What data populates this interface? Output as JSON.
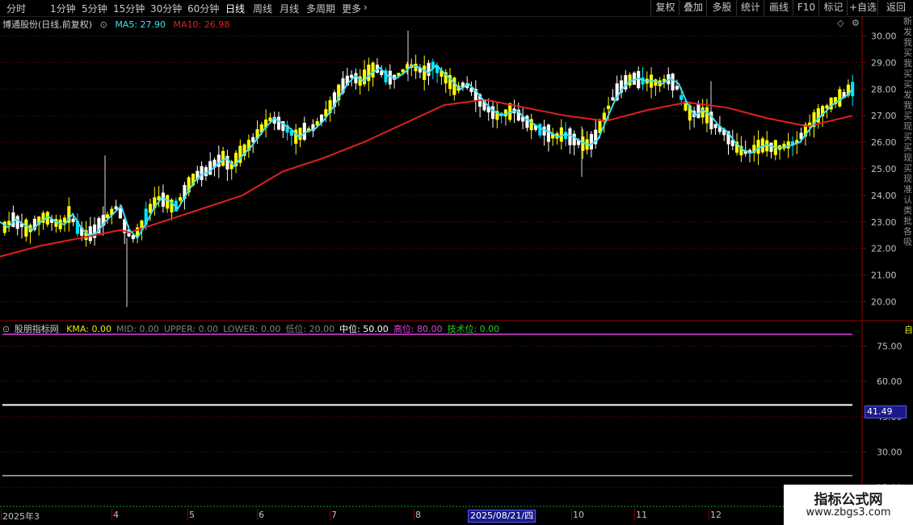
{
  "toolbar": {
    "periods": [
      "分时",
      "1分钟",
      "5分钟",
      "15分钟",
      "30分钟",
      "60分钟",
      "日线",
      "周线",
      "月线",
      "多周期",
      "更多"
    ],
    "active_period": "日线",
    "right_buttons": [
      "复权",
      "叠加",
      "多股",
      "统计",
      "画线",
      "F10",
      "标记",
      "+自选",
      "返回"
    ]
  },
  "main_panel": {
    "title": "博通股份(日线,前复权)",
    "ma5_label": "MA5:",
    "ma5_value": "27.90",
    "ma10_label": "MA10:",
    "ma10_value": "26.98",
    "price_ticks": [
      "30.00",
      "29.00",
      "28.00",
      "27.00",
      "26.00",
      "25.00",
      "24.00",
      "23.00",
      "22.00",
      "21.00",
      "20.00"
    ]
  },
  "indicator_panel": {
    "name": "股朋指标网",
    "items": [
      {
        "label": "KMA:",
        "value": "0.00",
        "color": "#e8e800"
      },
      {
        "label": "MID:",
        "value": "0.00",
        "color": "#808080"
      },
      {
        "label": "UPPER:",
        "value": "0.00",
        "color": "#808080"
      },
      {
        "label": "LOWER:",
        "value": "0.00",
        "color": "#808080"
      },
      {
        "label": "低位:",
        "value": "20.00",
        "color": "#808080"
      },
      {
        "label": "中位:",
        "value": "50.00",
        "color": "#ffffff"
      },
      {
        "label": "高位:",
        "value": "80.00",
        "color": "#e040e0"
      },
      {
        "label": "技术位:",
        "value": "0.00",
        "color": "#20d020"
      }
    ],
    "ticks": [
      "75.00",
      "60.00",
      "45.00",
      "30.00",
      "15.00"
    ],
    "cursor_value": "41.49"
  },
  "date_axis": {
    "labels": [
      "2025年3",
      "4",
      "5",
      "6",
      "7",
      "8",
      "10",
      "11",
      "12"
    ],
    "cursor_date": "2025/08/21/四"
  },
  "side_strip": {
    "top_chars": "新发我买我买买发我买现买买现买现 准认 类 批 各 吸",
    "bottom_chars": "自"
  },
  "watermark": {
    "line1": "指标公式网",
    "line2": "www.zbgs3.com"
  },
  "colors": {
    "up_candle": "#ffff00",
    "down_candle": "#ffffff",
    "special_candle": "#00e5ff",
    "ma5": "#40e0f0",
    "ma10": "#e02020",
    "grid": "#8b0000"
  },
  "chart_data": {
    "type": "candlestick",
    "price_ylim": [
      19.5,
      30.5
    ],
    "ma5_path": [
      [
        0,
        23.0
      ],
      [
        10,
        22.8
      ],
      [
        20,
        23.1
      ],
      [
        30,
        22.9
      ],
      [
        40,
        22.7
      ],
      [
        50,
        23.0
      ],
      [
        60,
        23.2
      ],
      [
        70,
        23.0
      ],
      [
        80,
        22.9
      ],
      [
        90,
        23.3
      ],
      [
        100,
        22.8
      ],
      [
        110,
        22.5
      ],
      [
        120,
        22.6
      ],
      [
        130,
        23.0
      ],
      [
        140,
        23.3
      ],
      [
        150,
        23.6
      ],
      [
        160,
        22.7
      ],
      [
        170,
        22.4
      ],
      [
        180,
        22.9
      ],
      [
        190,
        23.5
      ],
      [
        200,
        23.9
      ],
      [
        210,
        23.8
      ],
      [
        220,
        23.5
      ],
      [
        230,
        24.0
      ],
      [
        240,
        24.5
      ],
      [
        250,
        24.8
      ],
      [
        260,
        24.9
      ],
      [
        270,
        25.2
      ],
      [
        280,
        25.4
      ],
      [
        290,
        25.1
      ],
      [
        300,
        25.5
      ],
      [
        310,
        25.8
      ],
      [
        320,
        26.2
      ],
      [
        330,
        26.6
      ],
      [
        340,
        26.9
      ],
      [
        350,
        26.7
      ],
      [
        360,
        26.5
      ],
      [
        370,
        26.2
      ],
      [
        380,
        26.4
      ],
      [
        390,
        26.5
      ],
      [
        400,
        26.8
      ],
      [
        410,
        27.2
      ],
      [
        420,
        27.7
      ],
      [
        430,
        28.2
      ],
      [
        440,
        28.5
      ],
      [
        450,
        28.3
      ],
      [
        460,
        28.6
      ],
      [
        470,
        28.8
      ],
      [
        480,
        28.5
      ],
      [
        490,
        28.4
      ],
      [
        500,
        28.6
      ],
      [
        510,
        28.9
      ],
      [
        520,
        28.8
      ],
      [
        530,
        28.6
      ],
      [
        540,
        28.9
      ],
      [
        550,
        28.6
      ],
      [
        560,
        28.3
      ],
      [
        570,
        28.0
      ],
      [
        580,
        28.2
      ],
      [
        590,
        27.9
      ],
      [
        600,
        27.5
      ],
      [
        610,
        27.2
      ],
      [
        620,
        27.0
      ],
      [
        630,
        27.1
      ],
      [
        640,
        27.2
      ],
      [
        650,
        26.9
      ],
      [
        660,
        26.7
      ],
      [
        670,
        26.5
      ],
      [
        680,
        26.4
      ],
      [
        690,
        26.2
      ],
      [
        700,
        26.3
      ],
      [
        710,
        26.2
      ],
      [
        720,
        26.0
      ],
      [
        730,
        25.9
      ],
      [
        740,
        26.1
      ],
      [
        750,
        26.8
      ],
      [
        760,
        27.5
      ],
      [
        770,
        28.0
      ],
      [
        780,
        28.3
      ],
      [
        790,
        28.4
      ],
      [
        800,
        28.3
      ],
      [
        810,
        28.3
      ],
      [
        820,
        28.2
      ],
      [
        830,
        28.4
      ],
      [
        840,
        28.2
      ],
      [
        850,
        27.5
      ],
      [
        860,
        27.0
      ],
      [
        870,
        27.2
      ],
      [
        880,
        27.0
      ],
      [
        890,
        26.6
      ],
      [
        900,
        26.4
      ],
      [
        910,
        26.0
      ],
      [
        920,
        25.7
      ],
      [
        930,
        25.6
      ],
      [
        940,
        25.8
      ],
      [
        950,
        25.9
      ],
      [
        960,
        25.8
      ],
      [
        970,
        25.8
      ],
      [
        980,
        25.9
      ],
      [
        990,
        26.0
      ],
      [
        1000,
        26.4
      ],
      [
        1010,
        26.8
      ],
      [
        1020,
        27.1
      ],
      [
        1030,
        27.4
      ],
      [
        1040,
        27.6
      ],
      [
        1050,
        27.8
      ],
      [
        1055,
        28.0
      ]
    ],
    "ma10_path": [
      [
        0,
        21.7
      ],
      [
        50,
        22.1
      ],
      [
        100,
        22.4
      ],
      [
        150,
        22.7
      ],
      [
        160,
        22.6
      ],
      [
        200,
        23.0
      ],
      [
        250,
        23.5
      ],
      [
        300,
        24.0
      ],
      [
        350,
        24.9
      ],
      [
        400,
        25.4
      ],
      [
        450,
        26.0
      ],
      [
        500,
        26.7
      ],
      [
        550,
        27.4
      ],
      [
        600,
        27.6
      ],
      [
        650,
        27.3
      ],
      [
        700,
        27.0
      ],
      [
        750,
        26.8
      ],
      [
        800,
        27.2
      ],
      [
        850,
        27.5
      ],
      [
        900,
        27.3
      ],
      [
        950,
        26.9
      ],
      [
        1000,
        26.6
      ],
      [
        1055,
        27.0
      ]
    ],
    "indicator_levels": [
      {
        "name": "高位",
        "value": 80
      },
      {
        "name": "中位",
        "value": 50
      },
      {
        "name": "低位",
        "value": 20
      }
    ],
    "indicator_ylim": [
      10,
      82
    ]
  }
}
